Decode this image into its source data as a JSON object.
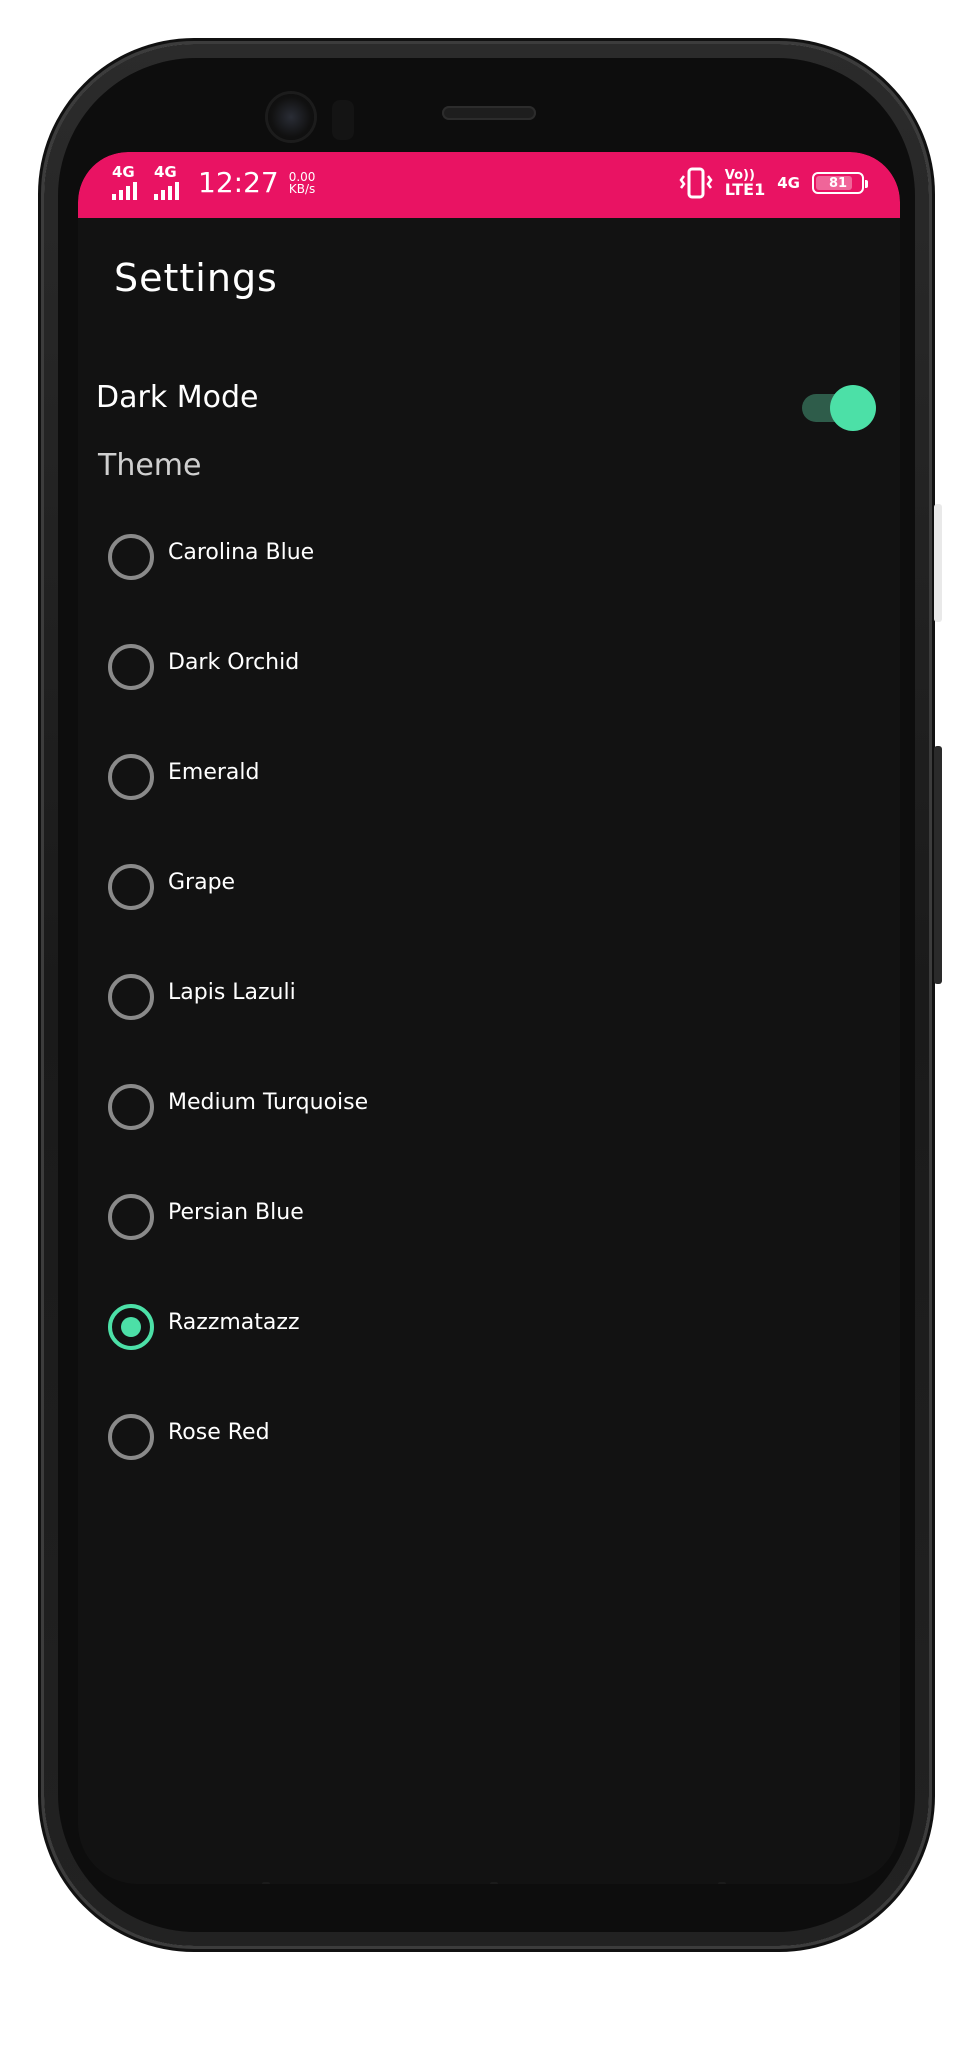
{
  "status_bar": {
    "sim1_net": "4G",
    "sim2_net": "4G",
    "time": "12:27",
    "speed_value": "0.00",
    "speed_unit": "KB/s",
    "volte_top": "Vo))",
    "volte_bottom": "LTE1",
    "right_net": "4G",
    "battery_level": "81",
    "battery_fraction": 0.81,
    "background_color": "#e91363"
  },
  "page": {
    "title": "Settings"
  },
  "dark_mode": {
    "label": "Dark Mode",
    "enabled": true,
    "accent_color": "#4ce0a7"
  },
  "theme": {
    "section_label": "Theme",
    "selected": "Razzmatazz",
    "options": [
      {
        "label": "Carolina Blue",
        "checked": false
      },
      {
        "label": "Dark Orchid",
        "checked": false
      },
      {
        "label": "Emerald",
        "checked": false
      },
      {
        "label": "Grape",
        "checked": false
      },
      {
        "label": "Lapis Lazuli",
        "checked": false
      },
      {
        "label": "Medium Turquoise",
        "checked": false
      },
      {
        "label": "Persian Blue",
        "checked": false
      },
      {
        "label": "Razzmatazz",
        "checked": true
      },
      {
        "label": "Rose Red",
        "checked": false
      }
    ]
  },
  "icons": {
    "vibrate": "vibrate-icon",
    "signal": "signal-bars-icon",
    "battery": "battery-icon"
  }
}
